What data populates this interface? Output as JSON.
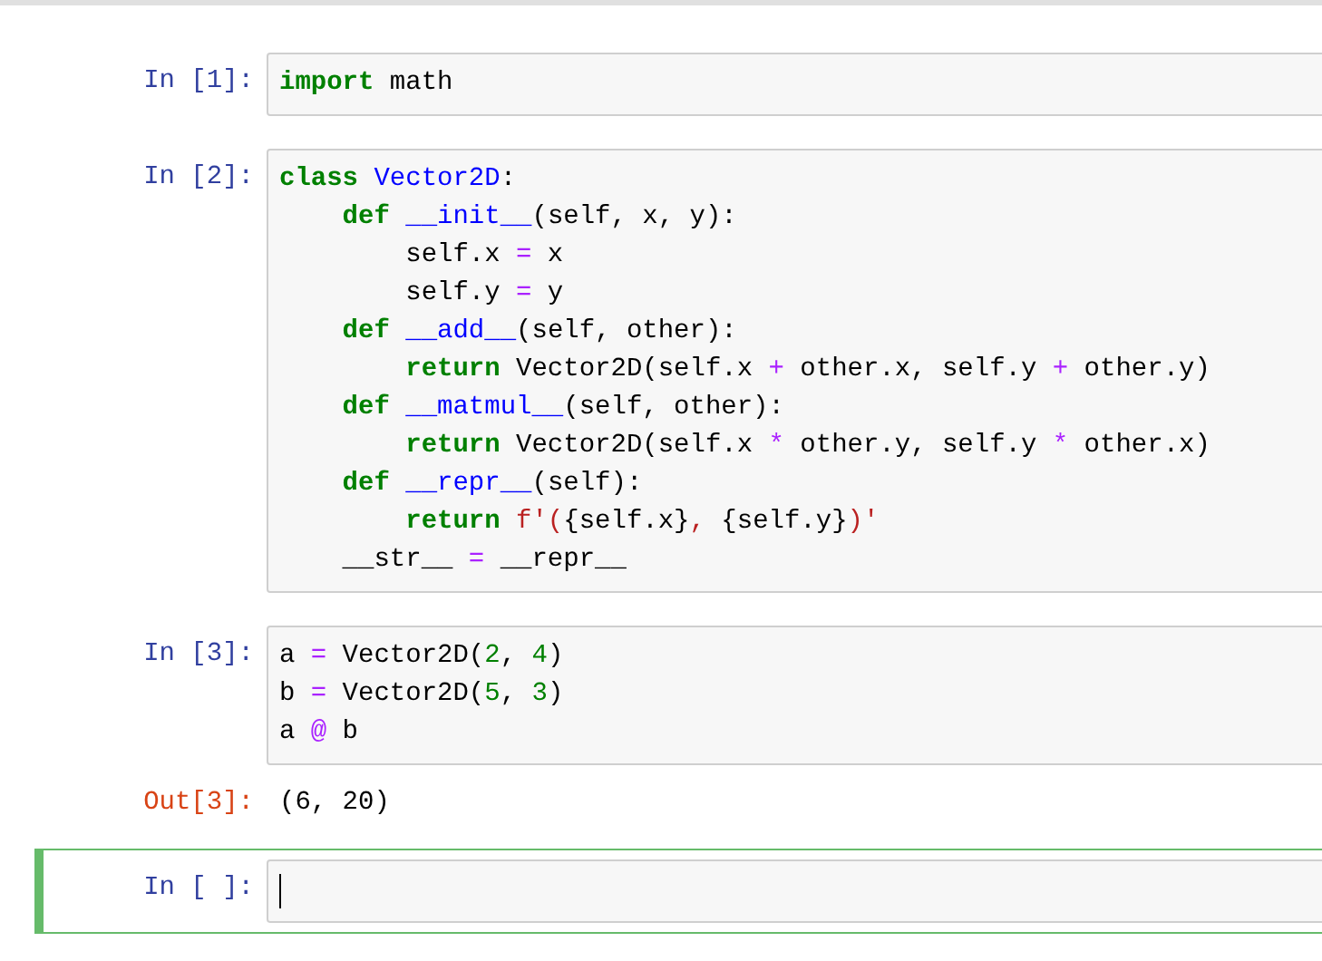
{
  "cells": [
    {
      "kind": "code",
      "prompt": "In [1]:",
      "selected": false,
      "lines": [
        [
          {
            "kind": "keyword",
            "text": "import"
          },
          {
            "kind": "plain",
            "text": " math"
          }
        ]
      ]
    },
    {
      "kind": "code",
      "prompt": "In [2]:",
      "selected": false,
      "lines": [
        [
          {
            "kind": "keyword",
            "text": "class"
          },
          {
            "kind": "name",
            "text": " Vector2D"
          },
          {
            "kind": "plain",
            "text": ":"
          }
        ],
        [
          {
            "kind": "keyword",
            "text": "    def"
          },
          {
            "kind": "name",
            "text": " __init__"
          },
          {
            "kind": "plain",
            "text": "(self, x, y):"
          }
        ],
        [
          {
            "kind": "plain",
            "text": "        self.x "
          },
          {
            "kind": "operator",
            "text": "="
          },
          {
            "kind": "plain",
            "text": " x"
          }
        ],
        [
          {
            "kind": "plain",
            "text": "        self.y "
          },
          {
            "kind": "operator",
            "text": "="
          },
          {
            "kind": "plain",
            "text": " y"
          }
        ],
        [
          {
            "kind": "keyword",
            "text": "    def"
          },
          {
            "kind": "name",
            "text": " __add__"
          },
          {
            "kind": "plain",
            "text": "(self, other):"
          }
        ],
        [
          {
            "kind": "keyword",
            "text": "        return"
          },
          {
            "kind": "plain",
            "text": " Vector2D(self.x "
          },
          {
            "kind": "operator",
            "text": "+"
          },
          {
            "kind": "plain",
            "text": " other.x, self.y "
          },
          {
            "kind": "operator",
            "text": "+"
          },
          {
            "kind": "plain",
            "text": " other.y)"
          }
        ],
        [
          {
            "kind": "keyword",
            "text": "    def"
          },
          {
            "kind": "name",
            "text": " __matmul__"
          },
          {
            "kind": "plain",
            "text": "(self, other):"
          }
        ],
        [
          {
            "kind": "keyword",
            "text": "        return"
          },
          {
            "kind": "plain",
            "text": " Vector2D(self.x "
          },
          {
            "kind": "operator",
            "text": "*"
          },
          {
            "kind": "plain",
            "text": " other.y, self.y "
          },
          {
            "kind": "operator",
            "text": "*"
          },
          {
            "kind": "plain",
            "text": " other.x)"
          }
        ],
        [
          {
            "kind": "keyword",
            "text": "    def"
          },
          {
            "kind": "name",
            "text": " __repr__"
          },
          {
            "kind": "plain",
            "text": "(self):"
          }
        ],
        [
          {
            "kind": "keyword",
            "text": "        return"
          },
          {
            "kind": "string",
            "text": " f'("
          },
          {
            "kind": "plain",
            "text": "{self.x}"
          },
          {
            "kind": "string",
            "text": ", "
          },
          {
            "kind": "plain",
            "text": "{self.y}"
          },
          {
            "kind": "string",
            "text": ")'"
          }
        ],
        [
          {
            "kind": "plain",
            "text": "    __str__ "
          },
          {
            "kind": "operator",
            "text": "="
          },
          {
            "kind": "plain",
            "text": " __repr__"
          }
        ]
      ]
    },
    {
      "kind": "code",
      "prompt": "In [3]:",
      "selected": false,
      "lines": [
        [
          {
            "kind": "plain",
            "text": "a "
          },
          {
            "kind": "operator",
            "text": "="
          },
          {
            "kind": "plain",
            "text": " Vector2D("
          },
          {
            "kind": "number",
            "text": "2"
          },
          {
            "kind": "plain",
            "text": ", "
          },
          {
            "kind": "number",
            "text": "4"
          },
          {
            "kind": "plain",
            "text": ")"
          }
        ],
        [
          {
            "kind": "plain",
            "text": "b "
          },
          {
            "kind": "operator",
            "text": "="
          },
          {
            "kind": "plain",
            "text": " Vector2D("
          },
          {
            "kind": "number",
            "text": "5"
          },
          {
            "kind": "plain",
            "text": ", "
          },
          {
            "kind": "number",
            "text": "3"
          },
          {
            "kind": "plain",
            "text": ")"
          }
        ],
        [
          {
            "kind": "plain",
            "text": "a "
          },
          {
            "kind": "operator",
            "text": "@"
          },
          {
            "kind": "plain",
            "text": " b"
          }
        ]
      ]
    },
    {
      "kind": "output",
      "prompt": "Out[3]:",
      "selected": false,
      "text": "(6, 20)"
    },
    {
      "kind": "code",
      "prompt": "In [ ]:",
      "selected": true
    }
  ]
}
